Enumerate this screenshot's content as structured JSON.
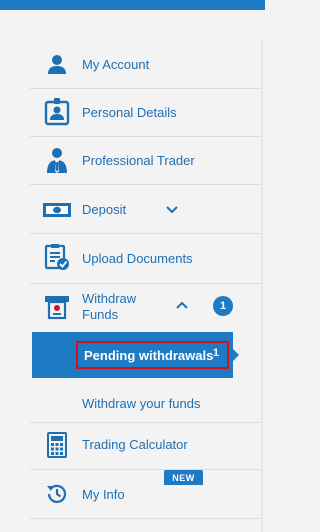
{
  "colors": {
    "accent": "#1f7ac4",
    "link": "#1f6fb3",
    "highlight_border": "#d0121b",
    "background": "#f3f3f3"
  },
  "menu": {
    "my_account": {
      "label": "My Account",
      "icon": "user-icon"
    },
    "personal_details": {
      "label": "Personal Details",
      "icon": "id-badge-icon"
    },
    "professional_trader": {
      "label": "Professional Trader",
      "icon": "businessman-icon"
    },
    "deposit": {
      "label": "Deposit",
      "icon": "banknote-icon",
      "expand_icon": "chevron-down-icon"
    },
    "upload_documents": {
      "label": "Upload Documents",
      "icon": "document-check-icon"
    },
    "withdraw_funds": {
      "label": "Withdraw Funds",
      "icon": "withdraw-wallet-icon",
      "collapse_icon": "chevron-up-icon",
      "count": "1",
      "sub_items": {
        "pending": {
          "label": "Pending withdrawals",
          "count": "1"
        },
        "withdraw": {
          "label": "Withdraw your funds"
        }
      }
    },
    "trading_calculator": {
      "label": "Trading Calculator",
      "icon": "calculator-icon"
    },
    "my_info": {
      "label": "My Info",
      "icon": "history-clock-icon",
      "badge": "NEW"
    }
  }
}
